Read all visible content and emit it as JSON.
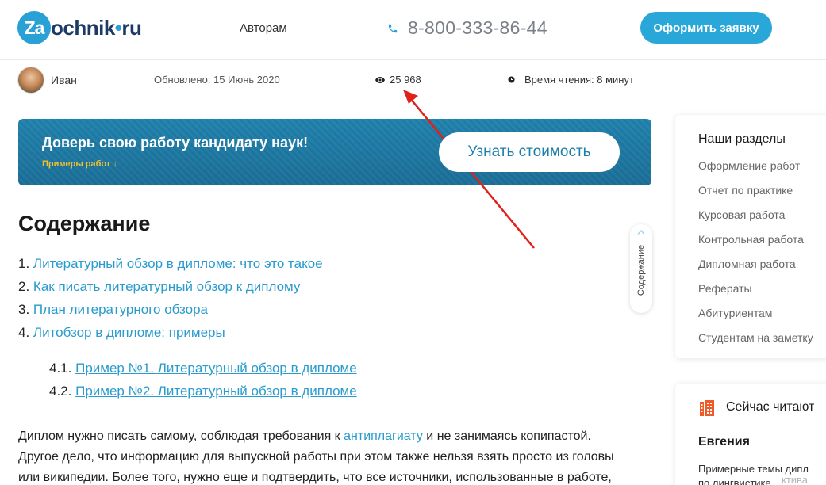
{
  "header": {
    "logo_letter": "Za",
    "logo_name": "ochnik",
    "logo_dot": "•",
    "logo_tld": "ru",
    "nav_authors": "Авторам",
    "phone": "8-800-333-86-44",
    "order_button": "Оформить заявку",
    "accent_color": "#29a7d9"
  },
  "meta": {
    "author": "Иван",
    "updated": "Обновлено: 15 Июнь 2020",
    "views": "25 968",
    "read_time": "Время чтения: 8 минут"
  },
  "banner": {
    "title": "Доверь свою работу кандидату наук!",
    "link": "Примеры работ ↓",
    "button": "Узнать стоимость"
  },
  "toc": {
    "title": "Содержание",
    "items": [
      {
        "num": "1.",
        "text": "Литературный обзор в дипломе: что это такое"
      },
      {
        "num": "2.",
        "text": "Как писать литературный обзор к диплому"
      },
      {
        "num": "3.",
        "text": "План литературного обзора"
      },
      {
        "num": "4.",
        "text": "Литобзор в дипломе: примеры"
      }
    ],
    "subitems": [
      {
        "num": "4.1.",
        "text": "Пример №1. Литературный обзор в дипломе "
      },
      {
        "num": "4.2.",
        "text": "Пример №2. Литературный обзор в дипломе"
      }
    ],
    "tab_label": "Содержание"
  },
  "body": {
    "line1_before": "Диплом нужно писать самому, соблюдая требования к ",
    "line1_link": "антиплагиату",
    "line1_after": " и не занимаясь копипастой.",
    "line2": "Другое дело, что информацию для выпускной работы при этом также нельзя взять просто из головы",
    "line3": "или википедии. Более того, нужно еще и подтвердить, что все источники, использованные в работе,"
  },
  "sidebar": {
    "title": "Наши разделы",
    "items": [
      "Оформление работ",
      "Отчет по практике",
      "Курсовая работа",
      "Контрольная работа",
      "Дипломная работа",
      "Рефераты",
      "Абитуриентам",
      "Студентам на заметку"
    ]
  },
  "now_reading": {
    "title": "Сейчас читают",
    "name": "Евгения",
    "desc_line1": "Примерные темы дипл",
    "desc_line2": "по лингвистике"
  },
  "watermark": "ктива"
}
